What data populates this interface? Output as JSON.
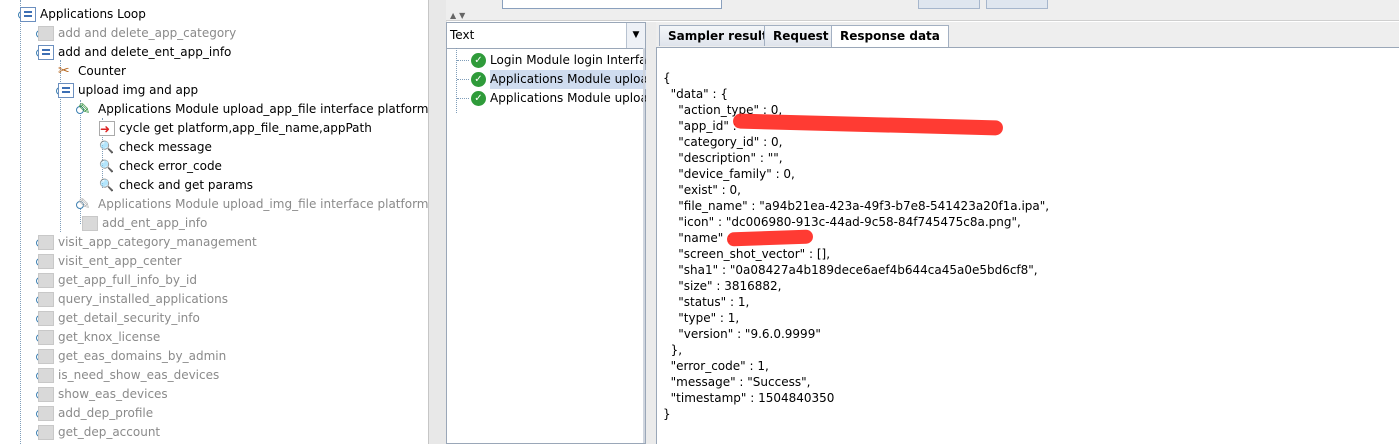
{
  "tree": {
    "items": [
      {
        "label": "Applications Loop",
        "disabled": false
      },
      {
        "label": "add and delete_app_category",
        "disabled": true
      },
      {
        "label": "add and delete_ent_app_info",
        "disabled": false
      },
      {
        "label": "Counter",
        "disabled": false
      },
      {
        "label": "upload img and app",
        "disabled": false
      },
      {
        "label": "Applications Module upload_app_file interface platform i",
        "disabled": false
      },
      {
        "label": "cycle get platform,app_file_name,appPath",
        "disabled": false
      },
      {
        "label": "check message",
        "disabled": false
      },
      {
        "label": "check error_code",
        "disabled": false
      },
      {
        "label": "check and get params",
        "disabled": false
      },
      {
        "label": "Applications Module upload_img_file interface platform i",
        "disabled": true
      },
      {
        "label": "add_ent_app_info",
        "disabled": true
      },
      {
        "label": "visit_app_category_management",
        "disabled": true
      },
      {
        "label": "visit_ent_app_center",
        "disabled": true
      },
      {
        "label": "get_app_full_info_by_id",
        "disabled": true
      },
      {
        "label": "query_installed_applications",
        "disabled": true
      },
      {
        "label": "get_detail_security_info",
        "disabled": true
      },
      {
        "label": "get_knox_license",
        "disabled": true
      },
      {
        "label": "get_eas_domains_by_admin",
        "disabled": true
      },
      {
        "label": "is_need_show_eas_devices",
        "disabled": true
      },
      {
        "label": "show_eas_devices",
        "disabled": true
      },
      {
        "label": "add_dep_profile",
        "disabled": true
      },
      {
        "label": "get_dep_account",
        "disabled": true
      }
    ]
  },
  "results": {
    "renderer": "Text",
    "items": [
      {
        "label": "Login Module login Interface",
        "selected": false
      },
      {
        "label": "Applications Module upload_",
        "selected": true
      },
      {
        "label": "Applications Module upload_",
        "selected": false
      }
    ]
  },
  "tabs": [
    {
      "label": "Sampler result",
      "active": false
    },
    {
      "label": "Request",
      "active": false
    },
    {
      "label": "Response data",
      "active": true
    }
  ],
  "response": {
    "lines": [
      "{",
      "  \"data\" : {",
      "    \"action_type\" : 0,",
      "    \"app_id\" :",
      "    \"category_id\" : 0,",
      "    \"description\" : \"\",",
      "    \"device_family\" : 0,",
      "    \"exist\" : 0,",
      "    \"file_name\" : \"a94b21ea-423a-49f3-b7e8-541423a20f1a.ipa\",",
      "    \"icon\" : \"dc006980-913c-44ad-9c58-84f745475c8a.png\",",
      "    \"name\" :",
      "    \"screen_shot_vector\" : [],",
      "    \"sha1\" : \"0a08427a4b189dece6aef4b644ca45a0e5bd6cf8\",",
      "    \"size\" : 3816882,",
      "    \"status\" : 1,",
      "    \"type\" : 1,",
      "    \"version\" : \"9.6.0.9999\"",
      "  },",
      "  \"error_code\" : 1,",
      "  \"message\" : \"Success\",",
      "  \"timestamp\" : 1504840350",
      "}"
    ]
  },
  "colors": {
    "redaction": "#ff2a22",
    "success_check": "#2f9b3a",
    "selection": "#cfdcef"
  }
}
